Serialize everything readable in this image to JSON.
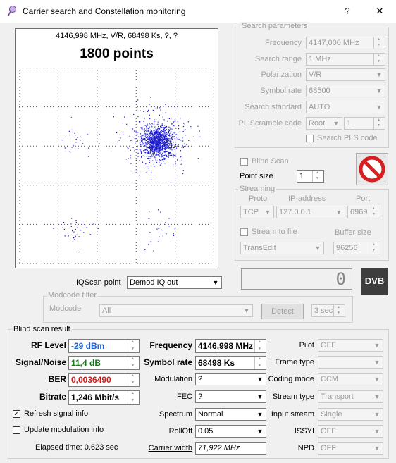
{
  "window": {
    "title": "Carrier search and Constellation monitoring",
    "help_label": "?",
    "close_label": "✕"
  },
  "scope": {
    "header": "4146,998 MHz, V/R, 68498 Ks, ?, ?",
    "points_label": "1800 points"
  },
  "search_params": {
    "group_title": "Search parameters",
    "frequency_label": "Frequency",
    "frequency_value": "4147,000 MHz",
    "search_range_label": "Search range",
    "search_range_value": "1 MHz",
    "polarization_label": "Polarization",
    "polarization_value": "V/R",
    "symbol_rate_label": "Symbol rate",
    "symbol_rate_value": "68500",
    "search_standard_label": "Search standard",
    "search_standard_value": "AUTO",
    "pl_scramble_label": "PL Scramble code",
    "pl_scramble_mode": "Root",
    "pl_scramble_value": "1",
    "search_pls_label": "Search PLS code"
  },
  "blind_scan_label": "Blind Scan",
  "point_size_label": "Point size",
  "point_size_value": "1",
  "streaming": {
    "group_title": "Streaming",
    "proto_label": "Proto",
    "proto_value": "TCP",
    "ip_label": "IP-address",
    "ip_value": "127.0.0.1",
    "port_label": "Port",
    "port_value": "6969",
    "stream_to_file_label": "Stream to file",
    "buffer_label": "Buffer size",
    "target_value": "TransEdit",
    "buffer_value": "96256"
  },
  "counter_value": "0",
  "dvb_logo": "DVB",
  "iqscan": {
    "label": "IQScan point",
    "value": "Demod IQ out"
  },
  "modcode": {
    "group_title": "Modcode filter",
    "label": "Modcode",
    "value": "All",
    "detect_label": "Detect",
    "interval_value": "3 sec"
  },
  "result": {
    "group_title": "Blind scan result",
    "rf_level_label": "RF Level",
    "rf_level_value": "-29 dBm",
    "snr_label": "Signal/Noise",
    "snr_value": "11,4 dB",
    "ber_label": "BER",
    "ber_value": "0,0036490",
    "bitrate_label": "Bitrate",
    "bitrate_value": "1,246 Mbit/s",
    "frequency_label": "Frequency",
    "frequency_value": "4146,998 MHz",
    "symbol_rate_label": "Symbol rate",
    "symbol_rate_value": "68498 Ks",
    "modulation_label": "Modulation",
    "modulation_value": "?",
    "fec_label": "FEC",
    "fec_value": "?",
    "spectrum_label": "Spectrum",
    "spectrum_value": "Normal",
    "rolloff_label": "RollOff",
    "rolloff_value": "0.05",
    "carrier_width_label": "Carrier width",
    "carrier_width_value": "71,922 MHz",
    "pilot_label": "Pilot",
    "pilot_value": "OFF",
    "frame_type_label": "Frame type",
    "frame_type_value": "",
    "coding_mode_label": "Coding mode",
    "coding_mode_value": "CCM",
    "stream_type_label": "Stream type",
    "stream_type_value": "Transport",
    "input_stream_label": "Input stream",
    "input_stream_value": "Single",
    "issyi_label": "ISSYI",
    "issyi_value": "OFF",
    "npd_label": "NPD",
    "npd_value": "OFF",
    "refresh_label": "Refresh signal info",
    "update_mod_label": "Update modulation info",
    "elapsed_label": "Elapsed time: 0.623 sec"
  },
  "colors": {
    "rf_level": "#1a62d6",
    "snr": "#1a7a1a",
    "ber": "#d01a1a",
    "points": "#1a1acc",
    "stop": "#d81e1e"
  }
}
